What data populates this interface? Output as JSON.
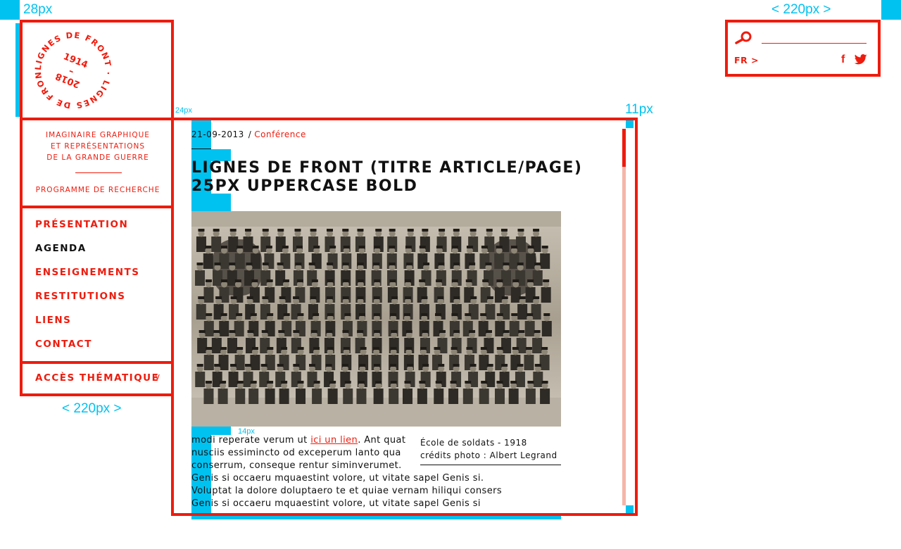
{
  "annotations": {
    "outer_margin": "28px",
    "right_panel_width": "< 220px >",
    "content_gap": "24px",
    "scroll_gap": "11px",
    "left_panel_width": "< 220px >",
    "text_gap": "14px"
  },
  "logo": {
    "ring_text": "LIGNES DE FRONT · LIGNES DE FRONT ·",
    "year_start": "1914",
    "dash": "–",
    "year_end": "2018"
  },
  "tagline": {
    "line1": "IMAGINAIRE GRAPHIQUE",
    "line2": "ET REPRÉSENTATIONS",
    "line3": "DE LA GRANDE GUERRE",
    "program": "PROGRAMME DE RECHERCHE"
  },
  "nav": {
    "items": [
      {
        "label": "PRÉSENTATION",
        "active": false
      },
      {
        "label": "AGENDA",
        "active": true
      },
      {
        "label": "ENSEIGNEMENTS",
        "active": false
      },
      {
        "label": "RESTITUTIONS",
        "active": false
      },
      {
        "label": "LIENS",
        "active": false
      },
      {
        "label": "CONTACT",
        "active": false
      }
    ],
    "thematic": {
      "label": "ACCÈS THÉMATIQUE",
      "chevron": "v"
    }
  },
  "search": {
    "icon": "search-icon",
    "placeholder": "",
    "lang": "FR >",
    "facebook_icon": "f",
    "twitter_icon": "twitter-icon"
  },
  "article": {
    "date": "21-09-2013",
    "separator": "/",
    "category": "Conférence",
    "title_line1": "LIGNES DE FRONT (TITRE ARTICLE/PAGE)",
    "title_line2": "25PX UPPERCASE BOLD",
    "body": {
      "p1_before": "modi reperate verum ut ",
      "p1_link": "ici un lien",
      "p1_after": ". Ant quat",
      "line2": "nusciis essimincto od exceperum lanto qua",
      "line3": "conserrum, conseque rentur siminverumet.",
      "line4": "Genis si occaeru mquaestint volore, ut vitate sapel Genis si.",
      "line5": " Voluptat la dolore doluptaero te et quiae vernam hiliqui consers",
      "line6": "Genis si occaeru mquaestint volore, ut vitate sapel Genis si"
    },
    "caption": {
      "line1": "École de soldats - 1918",
      "line2": "crédits photo :  Albert Legrand"
    }
  },
  "colors": {
    "accent": "#ee1c0e",
    "guide": "#00c2f0",
    "scroll_track": "#f5b5a8",
    "text": "#111111"
  }
}
